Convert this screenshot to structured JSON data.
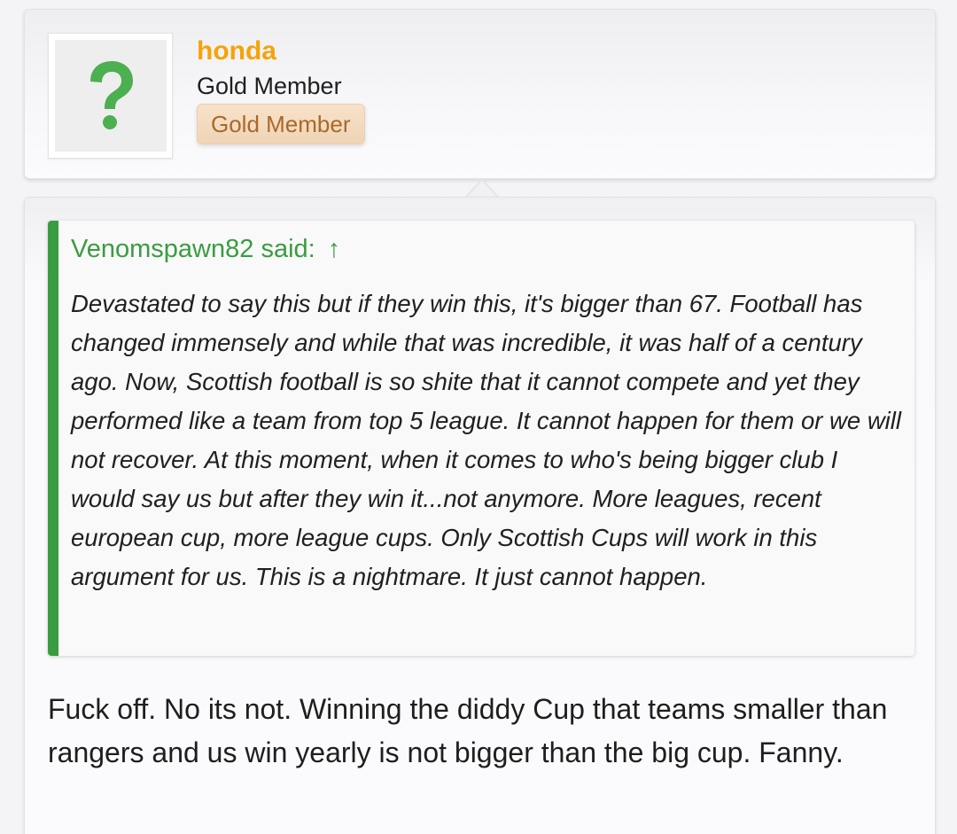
{
  "user": {
    "username": "honda",
    "user_title": "Gold Member",
    "banner": "Gold Member",
    "avatar_icon": "question-mark-icon",
    "colors": {
      "username": "#f5a30a",
      "avatar_glyph": "#4caf50"
    }
  },
  "quote": {
    "author": "Venomspawn82",
    "said_label": "said:",
    "jump_icon": "up-arrow-icon",
    "jump_glyph": "↑",
    "text": "Devastated to say this but if they win this, it's bigger than 67. Football has changed immensely and while that was incredible, it was half of a century ago. Now, Scottish football is so shite that it cannot compete and yet they performed like a team from top 5 league. It cannot happen for them or we will not recover. At this moment, when it comes to who's being bigger club I would say us but after they win it...not anymore. More leagues, recent european cup, more league cups. Only Scottish Cups will work in this argument for us. This is a nightmare. It just cannot happen.",
    "accent_color": "#3a9c41"
  },
  "reply": {
    "text": "Fuck off. No its not. Winning the diddy Cup that teams smaller than rangers and us win yearly is not bigger than the big cup. Fanny."
  }
}
